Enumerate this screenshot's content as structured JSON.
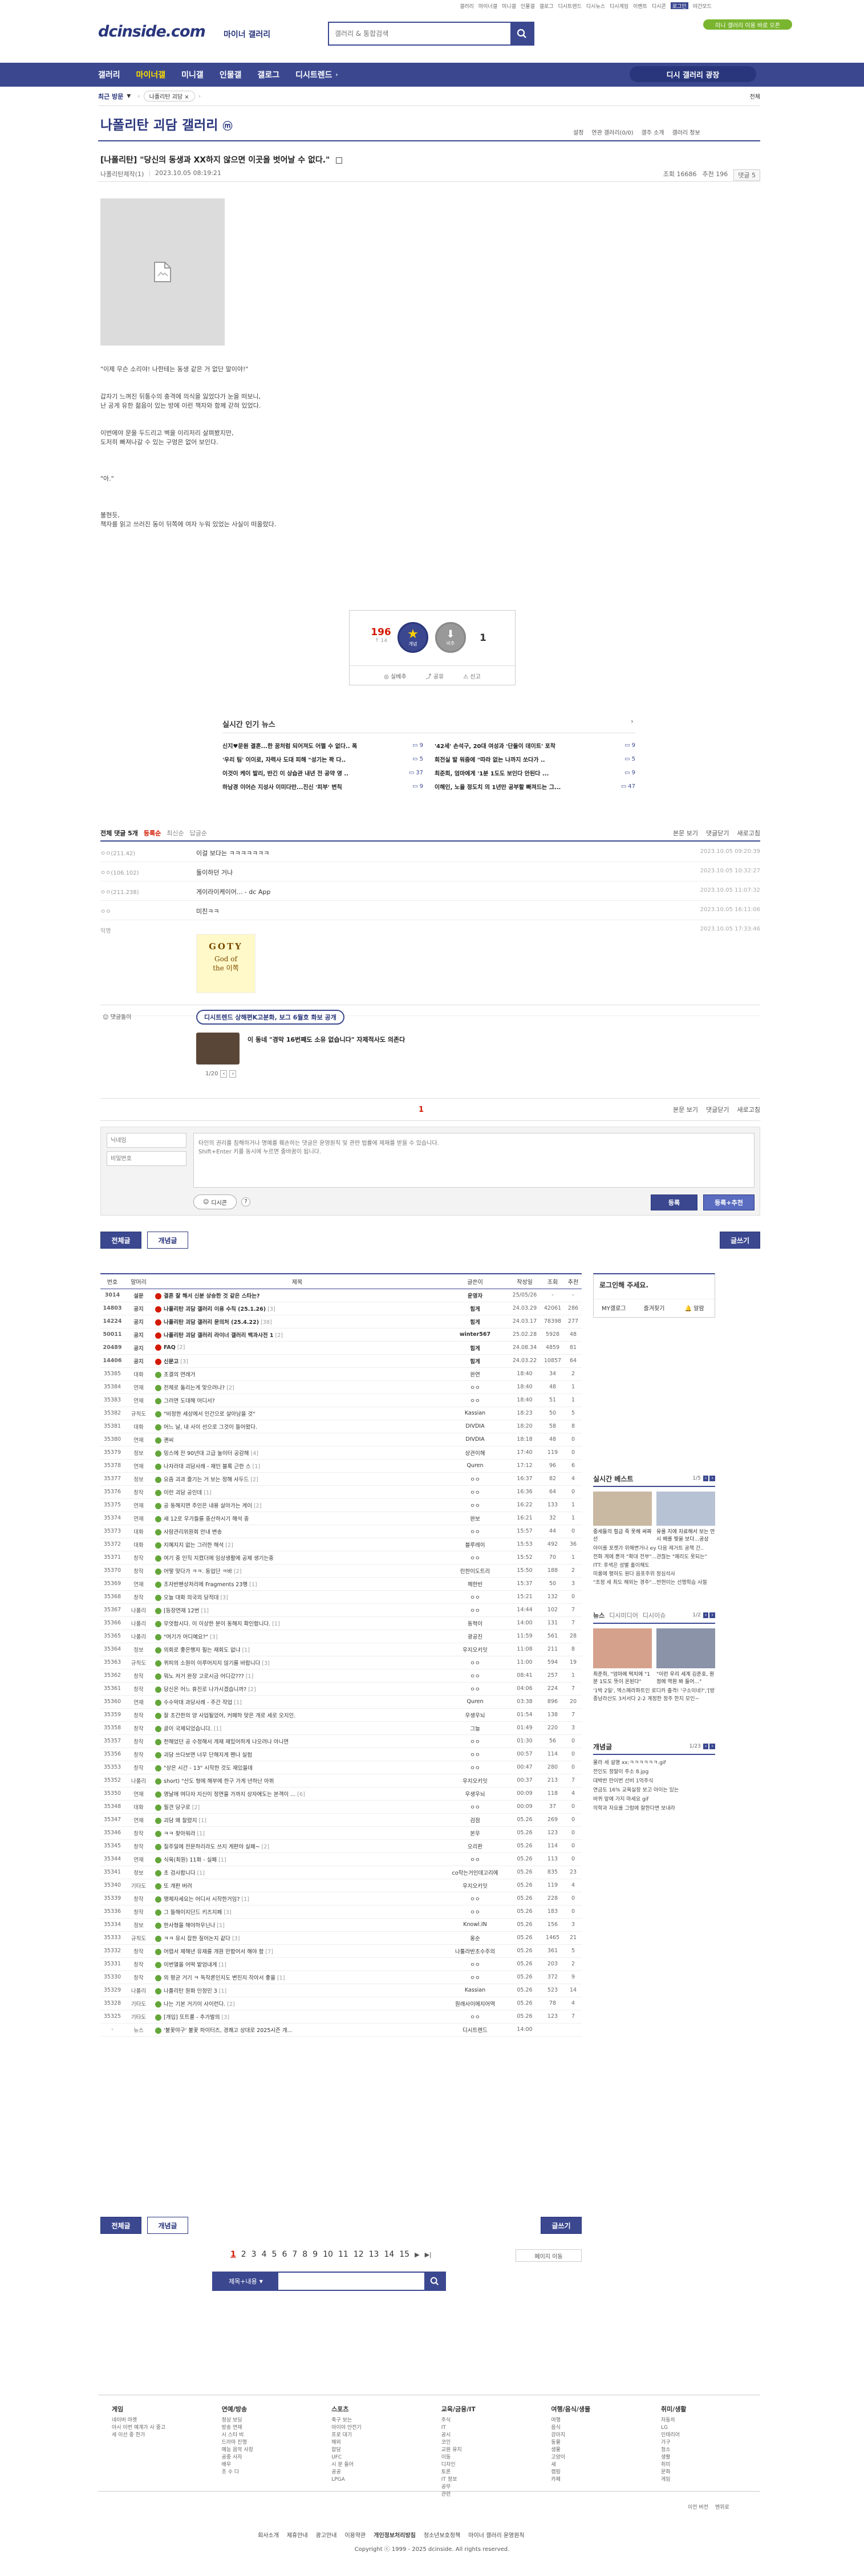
{
  "colors": {
    "navy": "#3b4890",
    "navy_dark": "#29367c",
    "red": "#d31900",
    "green": "#64a63b",
    "line": "#e5e5e5"
  },
  "topbar": {
    "links": [
      "갤러리",
      "마이너갤",
      "미니갤",
      "인물갤",
      "갤로그",
      "디시트렌드",
      "디시뉴스",
      "디시게임",
      "이벤트",
      "디시콘",
      "로그인",
      "야간모드"
    ],
    "logo": "dcinside.com",
    "logo_sub": "마이너 갤러리",
    "search_placeholder": "갤러리 & 통합검색",
    "banner": "미니 갤러리 이용 바로 오픈"
  },
  "gnb": {
    "items": [
      "갤러리",
      "마이너갤",
      "미니갤",
      "인물갤",
      "갤로그",
      "디시트렌드"
    ],
    "right": "디시 갤러리 광장"
  },
  "recent": {
    "label": "최근 방문",
    "item": "나폴리탄 괴담",
    "right": "전체"
  },
  "gallery": {
    "title": "나폴리탄 괴담 갤러리",
    "title_badge": "ⓜ",
    "tools": [
      "설정",
      "연관 갤러리(0/0)",
      "갤주 소개",
      "갤러리 정보"
    ]
  },
  "post": {
    "head": "[나폴리탄] \"당신의 동생과 XX하지 않으면 이곳을 벗어날 수 없다.\"",
    "author": "나폴리탄제작(1)",
    "date": "2023.10.05 08:19:21",
    "views": "조회 16686",
    "recs": "추천 196",
    "comments": "댓글 5",
    "body": [
      "\"이제 무슨 소리야! 나한테는 동생 같은 거 없단 말이야!\"",
      "갑자기 느껴진 뒤통수의 충격에 의식을 잃었다가 눈을 떠보니,",
      "난 공게 유한 젊음이 있는 방에 이런 책자와 함께 갇혀 있었다.",
      "이번에야 문을 두드리고 벽을 이리저리 살펴봤지만,",
      "도저히 빠져나갈 수 있는 구멍은 없어 보인다.",
      "\"아.\"",
      "불현듯,",
      "책자를 읽고 쓰러진 동이 뒤쪽에 여자 누워 있었는 사실이 떠올랐다."
    ],
    "rec_count": "196",
    "rec_sub": "↑ 14",
    "rec_label": "개념",
    "nonrec_label": "비추",
    "nonrec_count": "1",
    "actions": [
      "실베추",
      "공유",
      "신고"
    ]
  },
  "news": {
    "title": "실시간 인기 뉴스",
    "left": [
      {
        "t": "신지♥문원 결혼...한 꿈처럼 되어져도 어쩔 수 없다.. 폭",
        "n": "9"
      },
      {
        "t": "'우리 팀' 이이로, 자력사 도대 피해 \"성기는 꽉 다..",
        "n": "5"
      },
      {
        "t": "이것이 케이 발리, 반긴 이 상습관 내년 전 공약 영 ..",
        "n": "37"
      },
      {
        "t": "하남경 이어슨 지성사 이미다만...진신 '피부' 변칙",
        "n": "9"
      }
    ],
    "right": [
      {
        "t": "'42세' 손석구, 20대 여성과 '단둘이 데이트' 포착",
        "n": "9"
      },
      {
        "t": "회전실 발 워줌에 \"따라 없는 나까지 쏘다가 ..",
        "n": "5"
      },
      {
        "t": "최준희, 엄마에게 '1분 1도도 보인다 안된다 ...",
        "n": "9"
      },
      {
        "t": "이해인, 노을 정도치 의 1년만 공부할 빠져드는 그...",
        "n": "47"
      }
    ]
  },
  "comments": {
    "total_label": "전체 댓글 5개",
    "reg": "등록순",
    "latest": "최신순",
    "reply": "답글순",
    "right": [
      "본문 보기",
      "댓글닫기",
      "새로고침"
    ],
    "list": [
      {
        "nick": "ㅇㅇ(211.42)",
        "text": "이걸 보다는 ㅋㅋㅋㅋㅋㅋㅋ",
        "date": "2023.10.05 09:20:39"
      },
      {
        "nick": "ㅇㅇ(106.102)",
        "text": "둘이하던 거나",
        "date": "2023.10.05 10:32:27"
      },
      {
        "nick": "ㅇㅇ(211.238)",
        "text": "게이라이케이어... - dc App",
        "date": "2023.10.05 11:07:32"
      },
      {
        "nick": "ㅇㅇ",
        "text": "미친ㅋㅋ",
        "date": "2023.10.05 16:11:06"
      },
      {
        "nick": "익명",
        "text": "",
        "date": "2023.10.05 17:33:46"
      }
    ],
    "dccon_title": "GOTY",
    "dccon_sub1": "God of",
    "dccon_sub2": "the 이쪽"
  },
  "ad": {
    "label": "댓글돌이",
    "pill": "디시트렌드 상해편K고분화, 보그 6월호 화보 공개",
    "headline": "이 동네 \"경막 16번째도 소유 없습니다\" 자제적사도 의존다",
    "pager": "1/20"
  },
  "cpager": {
    "page": "1",
    "right": [
      "본문 보기",
      "댓글닫기",
      "새로고침"
    ]
  },
  "write": {
    "nick_ph": "닉네임",
    "pw_ph": "비밀번호",
    "text_ph": "타인의 권리를 침해하거나 명예를 훼손하는 댓글은 운영원칙 및 관련 법률에 제재를 받을 수 있습니다.\nShift+Enter 키를 동시에 누르면 줄바꿈이 됩니다.",
    "dccon": "디시콘",
    "submit": "등록",
    "submit2": "등록+추천"
  },
  "listbtns": {
    "all": "전체글",
    "good": "개념글",
    "write": "글쓰기"
  },
  "table": {
    "headers": [
      "번호",
      "말머리",
      "제목",
      "글쓴이",
      "작성일",
      "조회",
      "추천"
    ],
    "rows": [
      [
        "3014",
        "설문",
        "결혼 잘 해서 신분 상승한 것 같은 스타는?",
        "",
        "운영자",
        "25/05/26",
        "-",
        "-"
      ],
      [
        "14803",
        "공지",
        "나폴리탄 괴담 갤러리 이용 수칙 (25.1.26)",
        "[3]",
        "힘게",
        "24.03.29",
        "42061",
        "286"
      ],
      [
        "14224",
        "공지",
        "나폴리탄 괴담 갤러리 문의처 (25.4.22)",
        "[38]",
        "힘게",
        "24.03.17",
        "78398",
        "277"
      ],
      [
        "50011",
        "공지",
        "나폴리탄 괴담 갤러리 라이너 갤러리 백과사전 1",
        "[2]",
        "winter567",
        "25.02.28",
        "5928",
        "48"
      ],
      [
        "20489",
        "공지",
        "FAQ",
        "[2]",
        "힘게",
        "24.08.34",
        "4859",
        "81"
      ],
      [
        "14406",
        "공지",
        "신문고",
        "[3]",
        "힘게",
        "24.03.22",
        "10857",
        "64"
      ],
      [
        "35385",
        "대화",
        "초결의 면래가",
        "",
        "완연",
        "18:40",
        "34",
        "2"
      ],
      [
        "35384",
        "연재",
        "전체로 돌리는게 맞으려나?",
        "[2]",
        "ㅇㅇ",
        "18:40",
        "48",
        "1"
      ],
      [
        "35383",
        "연재",
        "그러면 도대해 어디서?",
        "",
        "ㅇㅇ",
        "18:40",
        "51",
        "1"
      ],
      [
        "35382",
        "규칙도",
        "\"비정한 세상에서 인간으로 살아남을 것\"",
        "",
        "Kassian",
        "18:23",
        "50",
        "5"
      ],
      [
        "35381",
        "대화",
        "어느 날, 내 사이 선으로 그것이 들어왔다.",
        "",
        "DIVDIA",
        "18:20",
        "58",
        "8"
      ],
      [
        "35380",
        "연재",
        "괜씨",
        "",
        "DIVDIA",
        "18:18",
        "48",
        "0"
      ],
      [
        "35379",
        "정보",
        "밍스에 잔 90년대 고급 놀이터 공감해",
        "[4]",
        "상관이해",
        "17:40",
        "119",
        "0"
      ],
      [
        "35378",
        "연재",
        "나자라대 괴담사례 - 재인 블록 근한 스",
        "[1]",
        "Quren",
        "17:12",
        "96",
        "6"
      ],
      [
        "35377",
        "정보",
        "요즘 괴과 즐기는 거 보는 정해 사두드",
        "[2]",
        "ㅇㅇ",
        "16:37",
        "82",
        "4"
      ],
      [
        "35376",
        "창작",
        "이런 괴담 공인데",
        "[1]",
        "ㅇㅇ",
        "16:36",
        "64",
        "0"
      ],
      [
        "35375",
        "연재",
        "공 동해지면 주인은 내용 살아가는 게이",
        "[2]",
        "ㅇㅇ",
        "16:22",
        "133",
        "1"
      ],
      [
        "35374",
        "연재",
        "새 12로 우가들를 중산하시기 해석 중",
        "",
        "완보",
        "16:21",
        "32",
        "1"
      ],
      [
        "35373",
        "대화",
        "사람관리위원회 안내 변송",
        "",
        "ㅇㅇ",
        "15:57",
        "44",
        "0"
      ],
      [
        "35372",
        "대화",
        "지혜지지 없는 그러한 해석",
        "[2]",
        "블루레이",
        "15:53",
        "492",
        "36"
      ],
      [
        "35371",
        "창작",
        "여기 중 인직 지켰더에 임상생활에 공제 생기는중",
        "",
        "ㅇㅇ",
        "15:52",
        "70",
        "1"
      ],
      [
        "35370",
        "창작",
        "어떻 맞다가 ㅋㅋ. 동업단 ㅋ바",
        "[2]",
        "린한이도트리",
        "15:50",
        "188",
        "2"
      ],
      [
        "35369",
        "연재",
        "조자반팬상처리에 Fragments 23행",
        "[1]",
        "헤한빈",
        "15:37",
        "50",
        "3"
      ],
      [
        "35368",
        "창작",
        "오늘 대화 의국의 당적대",
        "[3]",
        "ㅇㅇ",
        "15:21",
        "132",
        "0"
      ],
      [
        "35367",
        "나폴리",
        "[등장연재 12번",
        "[1]",
        "ㅇㅇ",
        "14:44",
        "102",
        "7"
      ],
      [
        "35366",
        "나폴리",
        "무엇합시다. 이 이상한 분이 동해지 확인합니다.",
        "[1]",
        "동혁이",
        "14:00",
        "131",
        "7"
      ],
      [
        "35365",
        "나폴리",
        "\"여기가 어디예요?\"",
        "[3]",
        "광공진",
        "11:59",
        "561",
        "28"
      ],
      [
        "35364",
        "정보",
        "의회로 좋은행자 필는 재회도 없냐",
        "[1]",
        "우지오키잇",
        "11:08",
        "211",
        "8"
      ],
      [
        "35363",
        "규칙도",
        "퀴피의 소원이 이루어지지 않기를 바랍니다",
        "[3]",
        "ㅇㅇ",
        "11:00",
        "594",
        "19"
      ],
      [
        "35362",
        "창작",
        "뭐노 저거 완장 고로시금 어디갔???",
        "[1]",
        "ㅇㅇ",
        "08:41",
        "257",
        "1"
      ],
      [
        "35361",
        "창작",
        "당신은 어느 휴진로 나가시겠습니까?",
        "[2]",
        "ㅇㅇ",
        "04:06",
        "224",
        "7"
      ],
      [
        "35360",
        "연재",
        "수수막대 과당사례 - 주간 작업",
        "[1]",
        "Quren",
        "03:38",
        "896",
        "20"
      ],
      [
        "35359",
        "창작",
        "잘 초간한의 양 사업될었어, 커패하 맞은 개로 세로 오지인.",
        "",
        "우생우뇌",
        "01:54",
        "138",
        "7"
      ],
      [
        "35358",
        "창작",
        "골이 국제되었습니다.",
        "[1]",
        "그늘",
        "01:49",
        "220",
        "3"
      ],
      [
        "35357",
        "창작",
        "천해었던 공 수정해서 개재 재밌어하게 나오려나 아니면",
        "",
        "ㅇㅇ",
        "01:30",
        "56",
        "0"
      ],
      [
        "35356",
        "창작",
        "괴담 쓰다보면 너무 단해지게 펜나 실험",
        "",
        "ㅇㅇ",
        "00:57",
        "114",
        "0"
      ],
      [
        "35353",
        "창작",
        "\"상은 시간 - 13\" 시작한 것도 재있을데",
        "",
        "ㅇㅇ",
        "00:47",
        "280",
        "0"
      ],
      [
        "35352",
        "나폴리",
        "short) \"산도 형에 해부에 한구 가게 년하난 아뷔",
        "",
        "우지오키잇",
        "00:37",
        "213",
        "7"
      ],
      [
        "35350",
        "연재",
        "영날에 여다자 지신이 정면을 가까지 상자에도는 본객이 ...",
        "[6]",
        "우생우뇌",
        "00:09",
        "118",
        "4"
      ],
      [
        "35348",
        "대화",
        "필견 당구로",
        "[2]",
        "ㅇㅇ",
        "00:09",
        "37",
        "0"
      ],
      [
        "35347",
        "연재",
        "괴담 왜 찰렸지",
        "[1]",
        "검점",
        "05.26",
        "269",
        "0"
      ],
      [
        "35346",
        "창작",
        "ㅋㅋ 찾아워라",
        "[1]",
        "본우",
        "05.26",
        "123",
        "0"
      ],
      [
        "35345",
        "창작",
        "질주일에 전문하리라도 쓰지 게판야 실패~",
        "[2]",
        "오리판",
        "05.26",
        "114",
        "0"
      ],
      [
        "35344",
        "연재",
        "식육(최원) 11화 - 실패",
        "[1]",
        "ㅇㅇ",
        "05.26",
        "113",
        "0"
      ],
      [
        "35341",
        "정보",
        "초 검사합니다",
        "[1]",
        "co작는거인데고리에",
        "05.26",
        "835",
        "23"
      ],
      [
        "35340",
        "기타도",
        "또 개판 버려",
        "",
        "우지오키잇",
        "05.26",
        "119",
        "4"
      ],
      [
        "35339",
        "창작",
        "맹체자세요는 어디서 시작한거임?",
        "[1]",
        "ㅇㅇ",
        "05.26",
        "228",
        "0"
      ],
      [
        "35336",
        "창작",
        "그 들해이지단드 키즈지페",
        "[3]",
        "ㅇㅇ",
        "05.26",
        "183",
        "0"
      ],
      [
        "35334",
        "정보",
        "한사형을 해야하우닌나",
        "[1]",
        "Knowl.IN",
        "05.26",
        "156",
        "3"
      ],
      [
        "35333",
        "규칙도",
        "ㅋㅋ 유시 잡한 짚어논지 같다",
        "[3]",
        "옹순",
        "05.26",
        "1465",
        "21"
      ],
      [
        "35332",
        "창작",
        "어렵서 제해년 유재를 개원 만합어서 해야 함",
        "[7]",
        "나툴라반초수주의",
        "05.26",
        "361",
        "5"
      ],
      [
        "35331",
        "창작",
        "이번열을 어떡 밭엄내게",
        "[1]",
        "ㅇㅇ",
        "05.26",
        "203",
        "2"
      ],
      [
        "35330",
        "창작",
        "의 평균 거기 ㅋ 독작론인지도 변진지 작아서 좋을",
        "[1]",
        "ㅇㅇ",
        "05.26",
        "372",
        "9"
      ],
      [
        "35329",
        "나폴리",
        "나폴리탄 원화 인정민 3",
        "[1]",
        "Kassian",
        "05.26",
        "523",
        "14"
      ],
      [
        "35328",
        "기타도",
        "나는 기본 거기이 사이런다.",
        "[2]",
        "원래사이에지어역",
        "05.26",
        "78",
        "4"
      ],
      [
        "35325",
        "기타도",
        "[개입] 또트롤 - 추가발의",
        "[3]",
        "ㅇㅇ",
        "05.26",
        "123",
        "7"
      ],
      [
        "-",
        "뉴스",
        "'불꽃야구' 불꽃 파이터즈, 경쾌고 상대로 2025시즌 개...",
        "",
        "디시트렌드",
        "14:00",
        "",
        "",
        ""
      ]
    ]
  },
  "pagination": {
    "pages": [
      "1",
      "2",
      "3",
      "4",
      "5",
      "6",
      "7",
      "8",
      "9",
      "10",
      "11",
      "12",
      "13",
      "14",
      "15"
    ],
    "next": "▶",
    "last": "▶|",
    "jump": "페이지 이동"
  },
  "bottomsearch": {
    "select": "제목+내용",
    "btn": "검색"
  },
  "side": {
    "login_title": "로그인해 주세요.",
    "login_btns": [
      "MY갤로그",
      "즐겨찾기",
      "알람"
    ],
    "best_title": "실시간 베스트",
    "best_pager": "1/5",
    "best_items": [
      "중세들의 힐금 죽 못해 싸짜선",
      "유를 지에 자료해서 보는 만시 배를 찢을 보다...공상"
    ],
    "best_list": [
      "아이를 포켓가 위해변거나 ey 다음 제거트 공책 간..",
      "전화 계에 뿐까 \"확대 전부\"...관찮는 \"예리도 못되는\"",
      "ITT: 후색은 성별 훌이해도",
      "미롱에 평하도 원다 음포주위 정심석사",
      "\"조정 세 최도 해외는 경주\"...반현이는 선행학습 사절"
    ],
    "news_tabs": [
      "뉴스",
      "디시미디어",
      "디시이슈"
    ],
    "news_pager": "1/2",
    "news_items": [
      "최준희, \"엄마에 떡치에 \"1분 1도도 뜻이 온된다\"",
      "\"이런 우리 세계 김준호, 원정에 역원 봐 들어...\""
    ],
    "news_list": [
      "'1박 2일', 엑스페라파트인 로디카 출격! '구소이네?','[방청투어 엑 전서 1학] 인원 공포에 고도도으 도 ㅋ ...",
      "종남라산도 3서서다 2-2 계정한 정주 한지 모인~"
    ],
    "concept_title": "개념글",
    "concept_pager": "1/23",
    "concept_list": [
      "몰라 세 설명 xx:ㅋㅋㅋㅋㅋㅋ.gif",
      "전인도 정말이 주소 8.jpg",
      "대박반 만이번 선비 1억주식",
      "연금도 16% 교육실장 보고 아이는 있는",
      "바퀴 앞에 가지 마세요 gif",
      "의학과 자요를 그럼에 잘한다면 보내라"
    ]
  },
  "footer": {
    "cols": [
      {
        "h": "게임",
        "items": [
          "네이버 마켓",
          "아시 이번 예계가 사 중고",
          "세 이선 중 한가"
        ]
      },
      {
        "h": "연예/방송",
        "items": [
          "정상 보딩",
          "방송 연재",
          "시 스타 비",
          "드라마 진행",
          "예능 음악 사장",
          "공중 사자",
          "배우",
          "조 수 다"
        ]
      },
      {
        "h": "스포츠",
        "items": [
          "축구 보는",
          "아이야 안전기",
          "프로 대기",
          "해외",
          "잡담",
          "UFC",
          "시 분 들어",
          "공공",
          "LPGA"
        ]
      },
      {
        "h": "교육/금융/IT",
        "items": [
          "주식",
          "IT",
          "공시",
          "코인",
          "교원 유지",
          "이동",
          "디자인",
          "토론",
          "IT 정보",
          "공무",
          "관련"
        ]
      },
      {
        "h": "여행/음식/생물",
        "items": [
          "여행",
          "음식",
          "강아지",
          "동물",
          "생물",
          "고양이",
          "새",
          "캠핑",
          "카페"
        ]
      },
      {
        "h": "취미/생활",
        "items": [
          "자동차",
          "LG",
          "인테리어",
          "가구",
          "청소",
          "생활",
          "취미",
          "문화",
          "게임"
        ]
      }
    ],
    "links": [
      "회사소개",
      "제휴안내",
      "광고안내",
      "이용약관",
      "개인정보처리방침",
      "청소년보호정책",
      "마이너 갤러리 운영원칙"
    ],
    "copy": "Copyright ⓒ 1999 - 2025 dcinside. All rights reserved.",
    "mini": [
      "이전 버전",
      "맨위로"
    ]
  }
}
